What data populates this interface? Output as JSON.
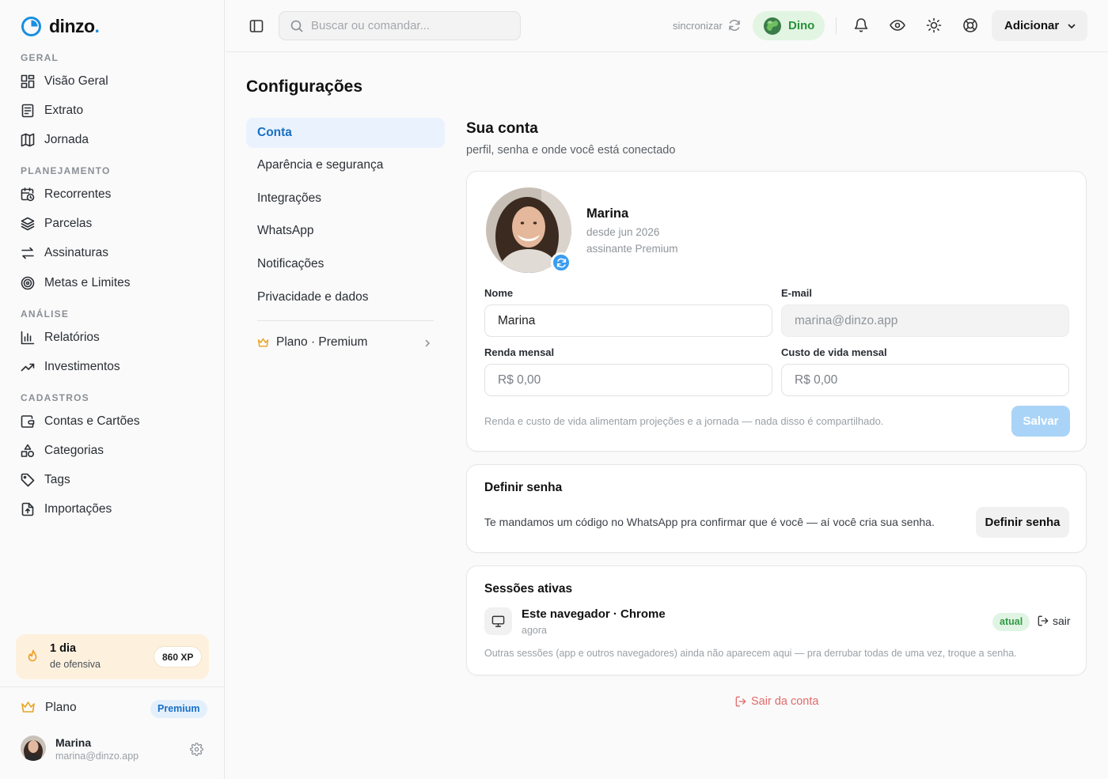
{
  "app": {
    "name": "dinzo",
    "name_dot": "."
  },
  "sidebar": {
    "sections": [
      {
        "title": "GERAL",
        "items": [
          {
            "label": "Visão Geral",
            "icon": "grid-icon"
          },
          {
            "label": "Extrato",
            "icon": "receipt-icon"
          },
          {
            "label": "Jornada",
            "icon": "map-icon"
          }
        ]
      },
      {
        "title": "PLANEJAMENTO",
        "items": [
          {
            "label": "Recorrentes",
            "icon": "calendar-clock-icon"
          },
          {
            "label": "Parcelas",
            "icon": "layers-icon"
          },
          {
            "label": "Assinaturas",
            "icon": "arrows-swap-icon"
          },
          {
            "label": "Metas e Limites",
            "icon": "target-icon"
          }
        ]
      },
      {
        "title": "ANÁLISE",
        "items": [
          {
            "label": "Relatórios",
            "icon": "bar-chart-icon"
          },
          {
            "label": "Investimentos",
            "icon": "trending-up-icon"
          }
        ]
      },
      {
        "title": "CADASTROS",
        "items": [
          {
            "label": "Contas e Cartões",
            "icon": "wallet-icon"
          },
          {
            "label": "Categorias",
            "icon": "shapes-icon"
          },
          {
            "label": "Tags",
            "icon": "tag-icon"
          },
          {
            "label": "Importações",
            "icon": "file-import-icon"
          }
        ]
      }
    ],
    "streak": {
      "days": "1 dia",
      "label": "de ofensiva",
      "xp": "860 XP"
    },
    "plan": {
      "label": "Plano",
      "badge": "Premium"
    },
    "user": {
      "name": "Marina",
      "email": "marina@dinzo.app"
    }
  },
  "topbar": {
    "search_placeholder": "Buscar ou comandar...",
    "sync_label": "sincronizar",
    "pet_name": "Dino",
    "add_label": "Adicionar"
  },
  "page": {
    "title": "Configurações",
    "settings_nav": [
      "Conta",
      "Aparência e segurança",
      "Integrações",
      "WhatsApp",
      "Notificações",
      "Privacidade e dados"
    ],
    "plan_link": "Plano · Premium",
    "account": {
      "title": "Sua conta",
      "subtitle": "perfil, senha e onde você está conectado",
      "profile": {
        "name": "Marina",
        "since": "desde jun 2026",
        "subscription": "assinante Premium"
      },
      "fields": {
        "name_label": "Nome",
        "name_value": "Marina",
        "email_label": "E-mail",
        "email_value": "marina@dinzo.app",
        "income_label": "Renda mensal",
        "income_value": "R$ 0,00",
        "cost_label": "Custo de vida mensal",
        "cost_value": "R$ 0,00"
      },
      "note": "Renda e custo de vida alimentam projeções e a jornada — nada disso é compartilhado.",
      "save_label": "Salvar"
    },
    "password": {
      "title": "Definir senha",
      "text": "Te mandamos um código no WhatsApp pra confirmar que é você — aí você cria sua senha.",
      "button": "Definir senha"
    },
    "sessions": {
      "title": "Sessões ativas",
      "current": {
        "name": "Este navegador · Chrome",
        "time": "agora",
        "badge": "atual",
        "action": "sair"
      },
      "note": "Outras sessões (app e outros navegadores) ainda não aparecem aqui — pra derrubar todas de uma vez, troque a senha."
    },
    "logout_label": "Sair da conta"
  },
  "colors": {
    "accent": "#1a6fc4",
    "brand_blue": "#1a8fe0",
    "success": "#27913a",
    "danger": "#e36a6a",
    "streak_bg": "#fdf1de"
  }
}
